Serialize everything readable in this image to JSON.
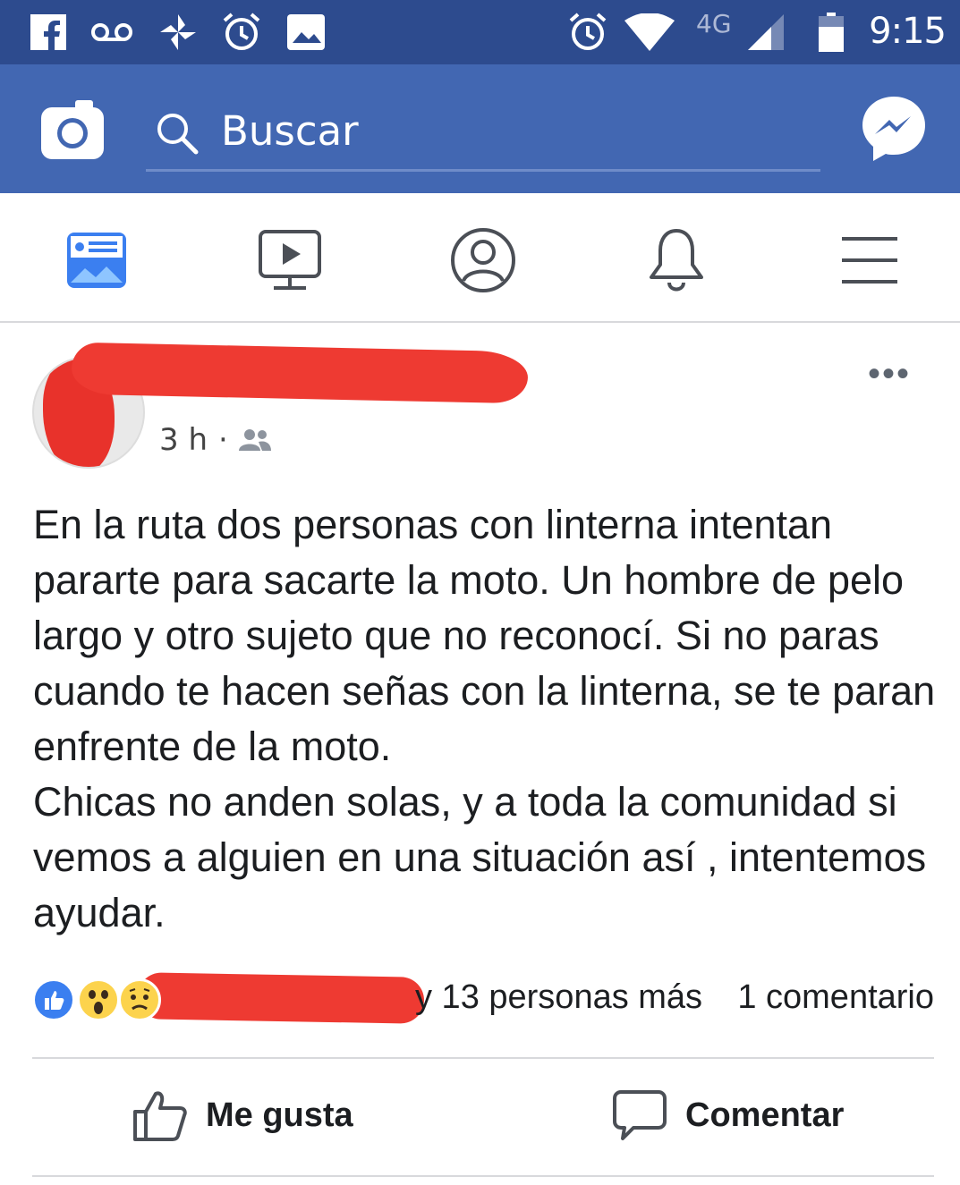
{
  "status_bar": {
    "time": "9:15",
    "network": "4G",
    "icons": [
      "facebook-icon",
      "voicemail-icon",
      "pinwheel-icon",
      "alarm-icon",
      "image-icon",
      "alarm-icon",
      "wifi-icon",
      "signal-icon",
      "battery-icon"
    ]
  },
  "app_bar": {
    "search_label": "Buscar",
    "icons": [
      "camera-icon",
      "search-icon",
      "messenger-icon"
    ]
  },
  "tabs": [
    {
      "name": "news-feed",
      "icon": "news-feed-icon",
      "active": true
    },
    {
      "name": "watch",
      "icon": "video-icon",
      "active": false
    },
    {
      "name": "profile",
      "icon": "profile-icon",
      "active": false
    },
    {
      "name": "notifications",
      "icon": "bell-icon",
      "active": false
    },
    {
      "name": "menu",
      "icon": "hamburger-icon",
      "active": false
    }
  ],
  "post": {
    "time": "3 h",
    "separator": "·",
    "audience_icon": "friends-icon",
    "more_label": "•••",
    "body": "En la ruta dos personas con linterna intentan pararte para sacarte la moto. Un hombre de pelo largo y otro sujeto que no reconocí. Si no paras cuando te hacen señas con la linterna, se te paran enfrente de la moto.\nChicas no anden solas, y a toda la comunidad si vemos a alguien en una situación así , intentemos ayudar.",
    "reactions_text": "y 13 personas más",
    "comments_count": "1 comentario",
    "like_label": "Me gusta",
    "comment_label": "Comentar"
  },
  "colors": {
    "status_bar_bg": "#2d4b8e",
    "app_bar_bg": "#4267b2",
    "redaction": "#ee3a32",
    "like_blue": "#3b7ff0"
  }
}
